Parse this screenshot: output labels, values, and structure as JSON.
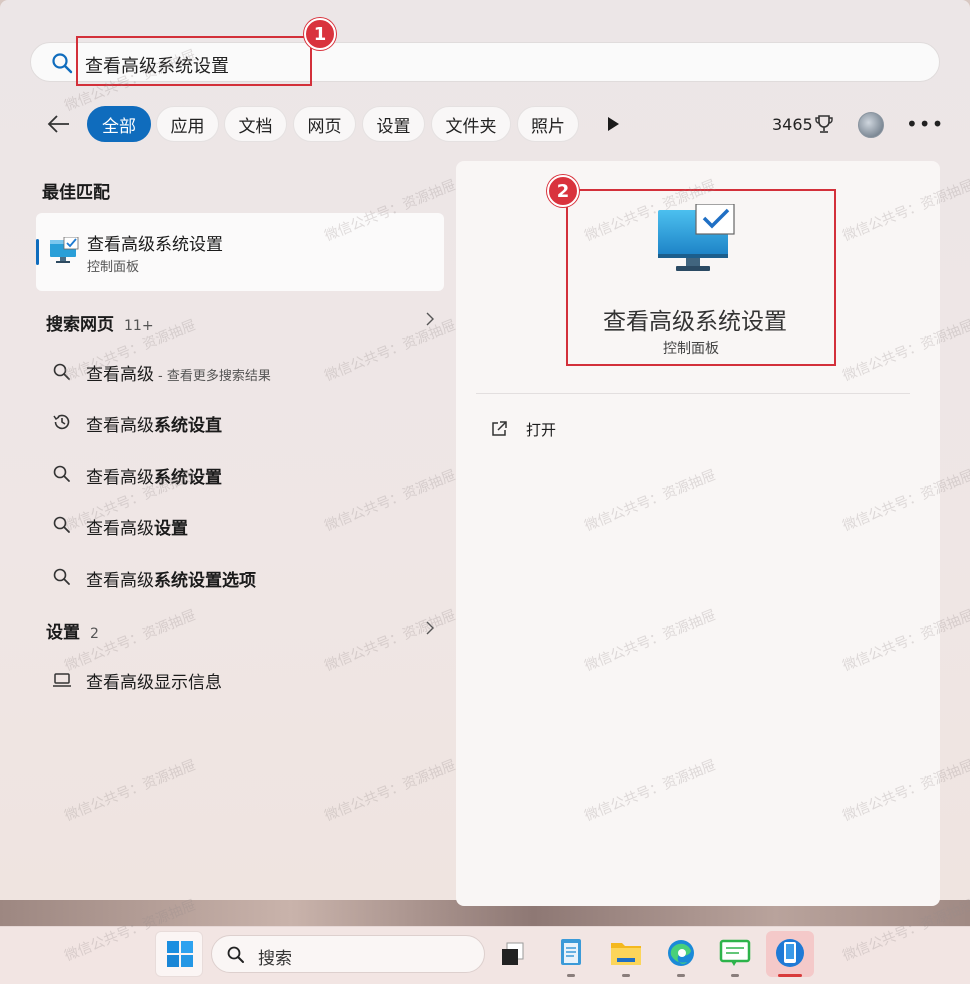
{
  "search": {
    "query": "查看高级系统设置"
  },
  "annotations": {
    "step1": "1",
    "step2": "2",
    "color": "#d3303a"
  },
  "filters": {
    "chips": [
      "全部",
      "应用",
      "文档",
      "网页",
      "设置",
      "文件夹",
      "照片"
    ],
    "active": "全部",
    "points": "3465"
  },
  "best_match": {
    "heading": "最佳匹配",
    "title": "查看高级系统设置",
    "subtitle": "控制面板"
  },
  "web_search": {
    "heading": "搜索网页",
    "count": "11+",
    "items": [
      {
        "prefix": "查看高级",
        "bold": "",
        "sub": "- 查看更多搜索结果",
        "icon": "search-icon"
      },
      {
        "prefix": "查看高级",
        "bold": "系统设直",
        "sub": "",
        "icon": "history-icon"
      },
      {
        "prefix": "查看高级",
        "bold": "系统设置",
        "sub": "",
        "icon": "search-icon"
      },
      {
        "prefix": "查看高级",
        "bold": "设置",
        "sub": "",
        "icon": "search-icon"
      },
      {
        "prefix": "查看高级",
        "bold": "系统设置选项",
        "sub": "",
        "icon": "search-icon"
      }
    ]
  },
  "settings_section": {
    "heading": "设置",
    "count": "2",
    "items": [
      {
        "label": "查看高级显示信息",
        "icon": "laptop-icon"
      }
    ]
  },
  "detail": {
    "title": "查看高级系统设置",
    "subtitle": "控制面板",
    "actions": [
      {
        "label": "打开",
        "icon": "open-external-icon"
      }
    ]
  },
  "taskbar": {
    "search_label": "搜索",
    "apps": [
      "start-icon",
      "task-view-icon",
      "notepad-icon",
      "file-explorer-icon",
      "edge-icon",
      "chat-icon",
      "phone-link-icon"
    ]
  },
  "watermark": "微信公共号：资源抽屉",
  "colors": {
    "accent": "#0f6cbd",
    "annotation_red": "#d3303a"
  }
}
